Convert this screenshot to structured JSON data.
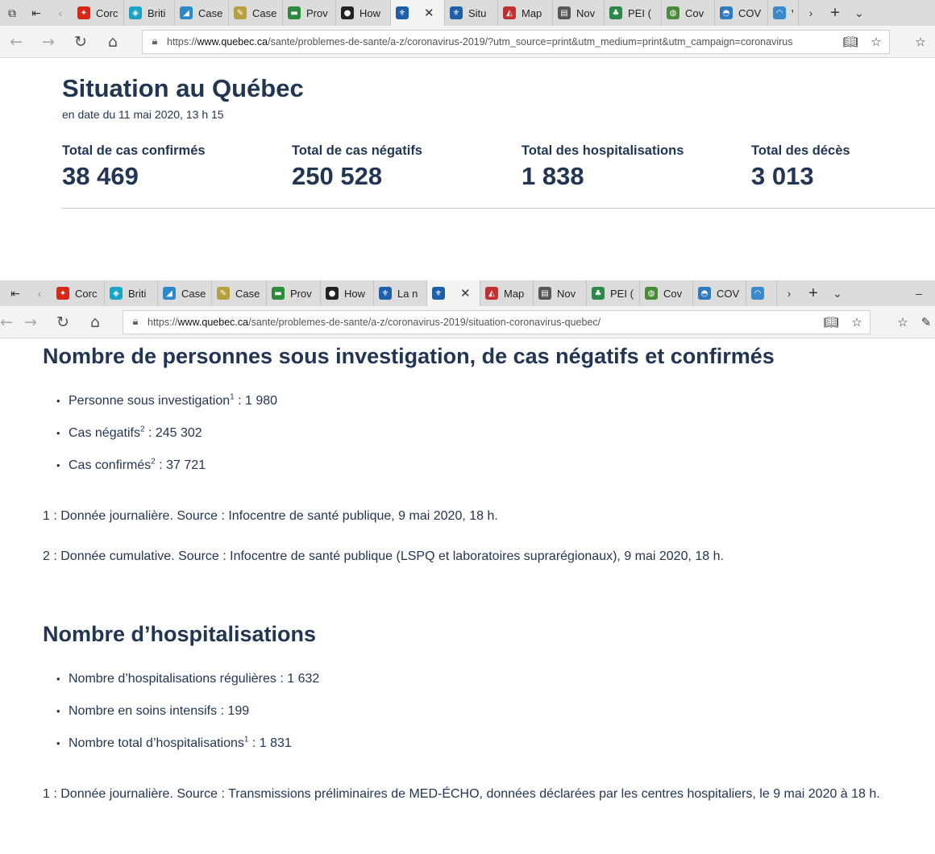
{
  "browser1": {
    "tabs": [
      {
        "label": "Corc",
        "icon": "canada-flag-icon",
        "color": "#d62718"
      },
      {
        "label": "Briti",
        "icon": "bc-logo-icon",
        "color": "#1ba3c4"
      },
      {
        "label": "Case",
        "icon": "chart-icon",
        "color": "#2b89c9"
      },
      {
        "label": "Case",
        "icon": "document-icon",
        "color": "#b8a040"
      },
      {
        "label": "Prov",
        "icon": "province-logo-icon",
        "color": "#2c8a3c"
      },
      {
        "label": "How",
        "icon": "circle-logo-icon",
        "color": "#222222"
      },
      {
        "label": "",
        "icon": "fleur-de-lis-icon",
        "color": "#1d5fa8"
      },
      {
        "label": "Situ",
        "icon": "fleur-de-lis-icon",
        "color": "#1d5fa8"
      },
      {
        "label": "Map",
        "icon": "map-icon",
        "color": "#c03030"
      },
      {
        "label": "Nov",
        "icon": "news-icon",
        "color": "#555555"
      },
      {
        "label": "PEI (",
        "icon": "pei-logo-icon",
        "color": "#2a8a4a"
      },
      {
        "label": "Cov",
        "icon": "globe-icon",
        "color": "#4a8a3a"
      },
      {
        "label": "COV",
        "icon": "nunavut-logo-icon",
        "color": "#2d7ac0"
      },
      {
        "label": "V",
        "icon": "yukon-logo-icon",
        "color": "#3a8acb"
      }
    ],
    "url_domain": "www.quebec.ca",
    "url_prefix": "https://",
    "url_path": "/sante/problemes-de-sante/a-z/coronavirus-2019/?utm_source=print&utm_medium=print&utm_campaign=coronavirus"
  },
  "situation": {
    "title": "Situation au Québec",
    "date": "en date du 11 mai 2020, 13 h 15",
    "stats": [
      {
        "label": "Total de cas confirmés",
        "value": "38 469"
      },
      {
        "label": "Total de cas négatifs",
        "value": "250 528"
      },
      {
        "label": "Total des hospitalisations",
        "value": "1 838"
      },
      {
        "label": "Total des décès",
        "value": "3 013"
      }
    ]
  },
  "browser2": {
    "tabs": [
      {
        "label": "Corc",
        "icon": "canada-flag-icon",
        "color": "#d62718"
      },
      {
        "label": "Briti",
        "icon": "bc-logo-icon",
        "color": "#1ba3c4"
      },
      {
        "label": "Case",
        "icon": "chart-icon",
        "color": "#2b89c9"
      },
      {
        "label": "Case",
        "icon": "document-icon",
        "color": "#b8a040"
      },
      {
        "label": "Prov",
        "icon": "province-logo-icon",
        "color": "#2c8a3c"
      },
      {
        "label": "How",
        "icon": "circle-logo-icon",
        "color": "#222222"
      },
      {
        "label": "La n",
        "icon": "fleur-de-lis-icon",
        "color": "#1d5fa8"
      },
      {
        "label": "",
        "icon": "fleur-de-lis-icon",
        "color": "#1d5fa8"
      },
      {
        "label": "Map",
        "icon": "map-icon",
        "color": "#c03030"
      },
      {
        "label": "Nov",
        "icon": "news-icon",
        "color": "#555555"
      },
      {
        "label": "PEI (",
        "icon": "pei-logo-icon",
        "color": "#2a8a4a"
      },
      {
        "label": "Cov",
        "icon": "globe-icon",
        "color": "#4a8a3a"
      },
      {
        "label": "COV",
        "icon": "nunavut-logo-icon",
        "color": "#2d7ac0"
      },
      {
        "label": "",
        "icon": "yukon-logo-icon",
        "color": "#3a8acb"
      }
    ],
    "url_domain": "www.quebec.ca",
    "url_prefix": "https://",
    "url_path": "/sante/problemes-de-sante/a-z/coronavirus-2019/situation-coronavirus-quebec/"
  },
  "section1": {
    "title": "Nombre de personnes sous investigation, de cas négatifs et confirmés",
    "items": [
      {
        "text": "Personne sous investigation",
        "sup": "1",
        "value": " : 1 980"
      },
      {
        "text": "Cas négatifs",
        "sup": "2",
        "value": " : 245 302"
      },
      {
        "text": "Cas confirmés",
        "sup": "2",
        "value": " : 37 721"
      }
    ],
    "note1": "1 : Donnée journalière. Source : Infocentre de santé publique, 9 mai 2020, 18 h.",
    "note2": "2 : Donnée cumulative. Source : Infocentre de santé publique (LSPQ et laboratoires suprarégionaux), 9 mai 2020, 18 h."
  },
  "section2": {
    "title": "Nombre d’hospitalisations",
    "items": [
      {
        "text": "Nombre d’hospitalisations régulières : 1 632",
        "sup": "",
        "value": ""
      },
      {
        "text": "Nombre en soins intensifs : 199",
        "sup": "",
        "value": ""
      },
      {
        "text": "Nombre total d’hospitalisations",
        "sup": "1",
        "value": " : 1 831"
      }
    ],
    "note1": "1 : Donnée journalière. Source : Transmissions préliminaires de MED-ÉCHO, données déclarées par les centres hospitaliers, le 9 mai 2020 à 18 h."
  }
}
